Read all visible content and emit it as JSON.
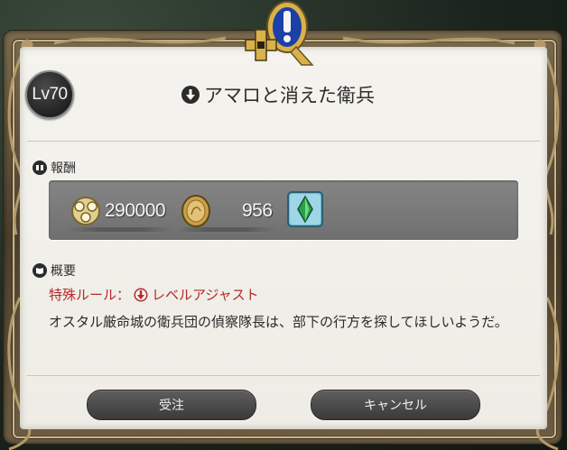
{
  "quest": {
    "level_label": "Lv70",
    "title": "アマロと消えた衛兵"
  },
  "rewards": {
    "section_label": "報酬",
    "gil_amount": "290000",
    "gil_icon": "gil-icon",
    "seal_amount": "956",
    "seal_icon": "coin-icon",
    "item_icon": "crystal-icon"
  },
  "summary": {
    "section_label": "概要",
    "special_rule_label": "特殊ルール：",
    "special_rule_value": "レベルアジャスト",
    "description": "オスタル厳命城の衛兵団の偵察隊長は、部下の行方を探してほしいようだ。"
  },
  "buttons": {
    "accept": "受注",
    "cancel": "キャンセル"
  },
  "colors": {
    "panel_bg": "#f0efe9",
    "frame": "#c9b489",
    "rule_red": "#b32a2a",
    "emblem_blue": "#1c3fa8",
    "emblem_gold": "#d8b24a"
  }
}
